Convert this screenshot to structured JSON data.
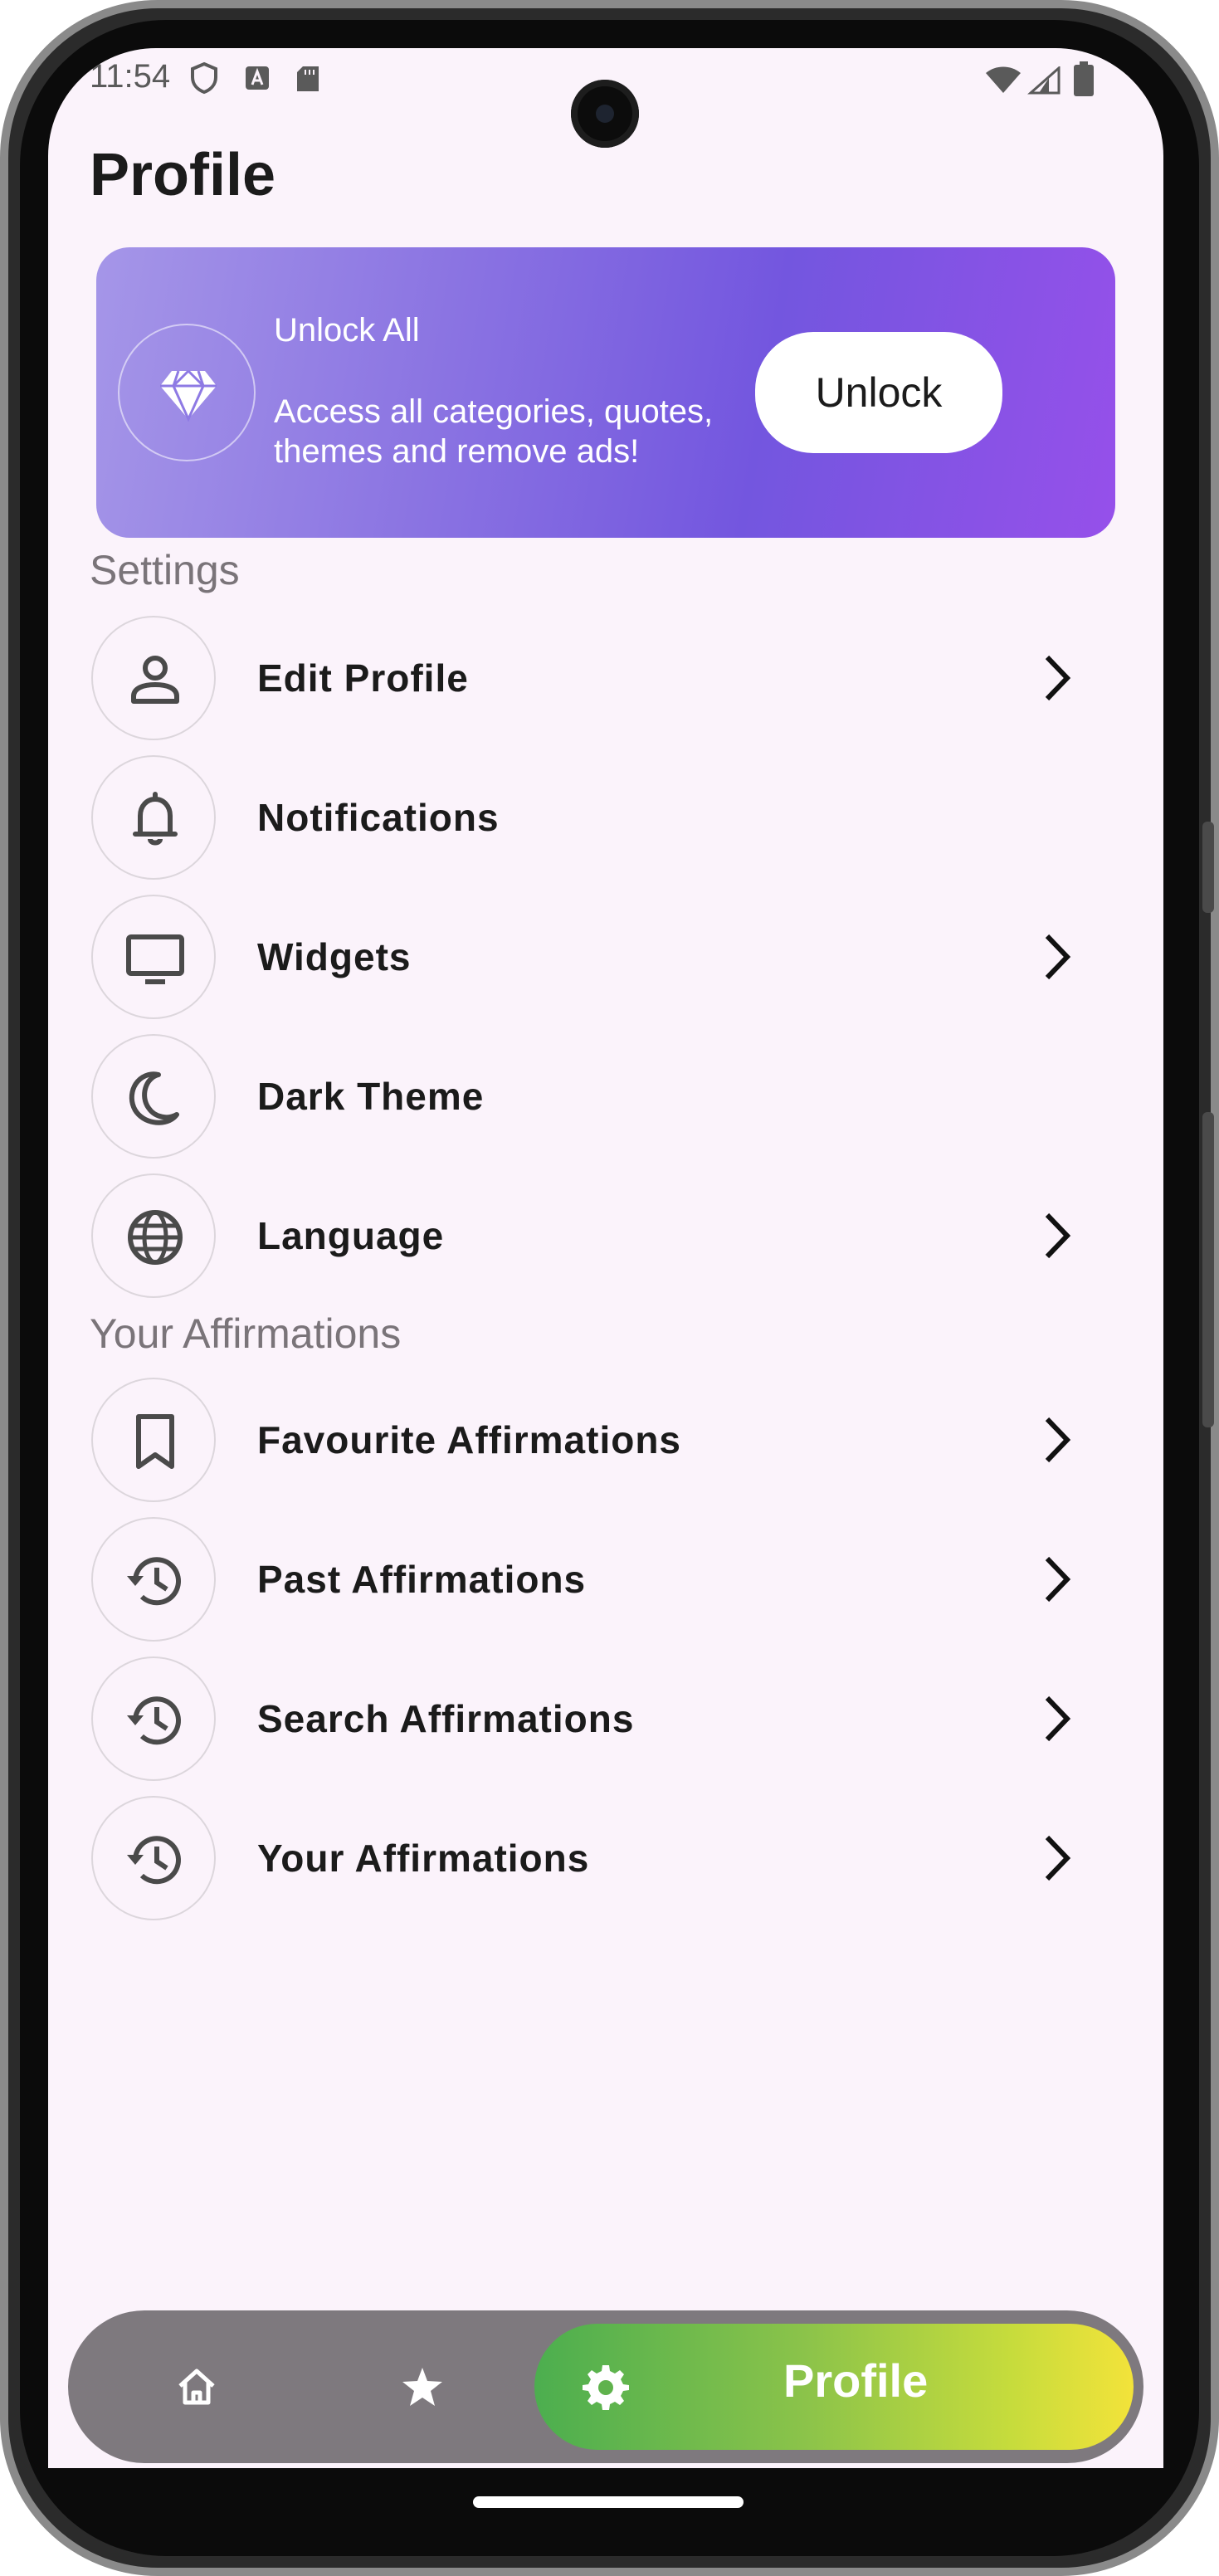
{
  "status_bar": {
    "time": "11:54"
  },
  "page_title": "Profile",
  "banner": {
    "title": "Unlock All",
    "description": "Access all categories, quotes, themes and remove ads!",
    "button_label": "Unlock",
    "icon": "diamond-icon"
  },
  "settings": {
    "section_title": "Settings",
    "items": [
      {
        "label": "Edit Profile",
        "icon": "person-icon",
        "has_chevron": true
      },
      {
        "label": "Notifications",
        "icon": "bell-icon",
        "has_chevron": false
      },
      {
        "label": "Widgets",
        "icon": "monitor-icon",
        "has_chevron": true
      },
      {
        "label": "Dark Theme",
        "icon": "moon-icon",
        "has_chevron": false
      },
      {
        "label": "Language",
        "icon": "globe-icon",
        "has_chevron": true
      }
    ]
  },
  "affirmations": {
    "section_title": "Your Affirmations",
    "items": [
      {
        "label": "Favourite Affirmations",
        "icon": "bookmark-icon",
        "has_chevron": true
      },
      {
        "label": "Past Affirmations",
        "icon": "history-icon",
        "has_chevron": true
      },
      {
        "label": "Search Affirmations",
        "icon": "history-icon",
        "has_chevron": true
      },
      {
        "label": "Your Affirmations",
        "icon": "history-icon",
        "has_chevron": true
      }
    ]
  },
  "bottom_nav": {
    "items": [
      {
        "icon": "home-icon"
      },
      {
        "icon": "star-icon"
      },
      {
        "icon": "gear-icon",
        "label": "Profile",
        "active": true
      }
    ]
  },
  "colors": {
    "background": "#fbf3fb",
    "banner_start": "#a596e8",
    "banner_end": "#9650ea",
    "nav_background": "#7e797e",
    "nav_active_start": "#4cae4f",
    "nav_active_end": "#f3e33a"
  }
}
